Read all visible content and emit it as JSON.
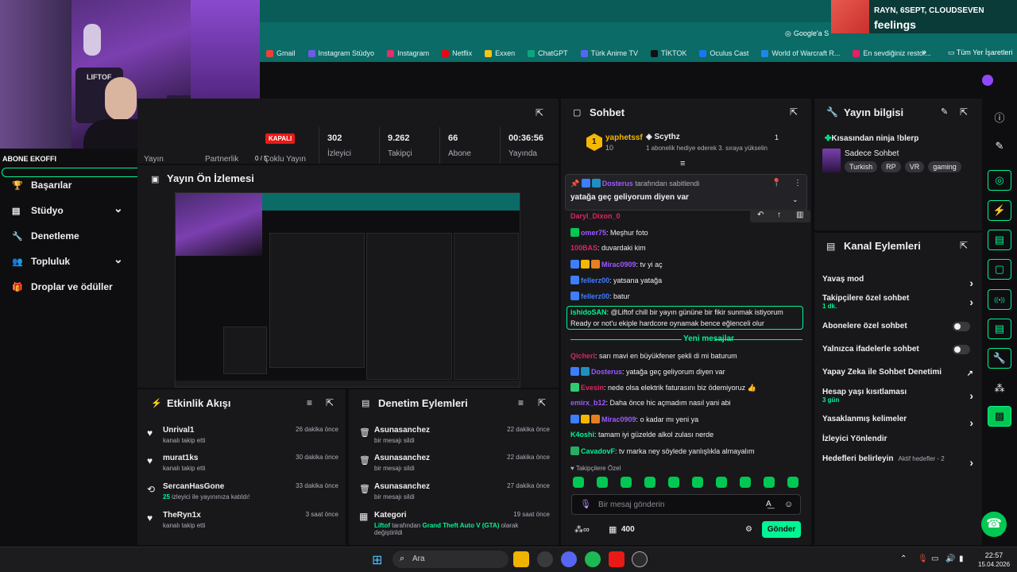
{
  "browser": {
    "google_chip": "Google'a S",
    "bookmarks": [
      "Gmail",
      "Instagram Stüdyo",
      "Instagram",
      "Netflix",
      "Exxen",
      "ChatGPT",
      "Türk Anime TV",
      "TİKTOK",
      "Oculus Cast",
      "World of Warcraft R...",
      "En sevdiğiniz restor..."
    ],
    "bookmark_colors": [
      "#ea4335",
      "#6c5ce7",
      "#e1306c",
      "#e50914",
      "#f5c518",
      "#10a37f",
      "#5865f2",
      "#111111",
      "#1877f2",
      "#1e88e5",
      "#e91e63"
    ],
    "overflow": "»",
    "all_bookmarks": "Tüm Yer İşaretleri"
  },
  "now_playing": {
    "artists": "RAYN, 6SEPT, CLOUDSEVEN",
    "song": "feelings"
  },
  "webcam": {
    "sign": "LIFTOF"
  },
  "left_nav": {
    "overlay_label": "ABONE EKOFFI",
    "items": [
      {
        "label": "Başarılar",
        "icon": "trophy-icon"
      },
      {
        "label": "Stüdyo",
        "icon": "studio-icon",
        "chevron": true
      },
      {
        "label": "Denetleme",
        "icon": "wrench-icon"
      },
      {
        "label": "Topluluk",
        "icon": "community-icon",
        "chevron": true
      },
      {
        "label": "Droplar ve ödüller",
        "icon": "gift-icon"
      }
    ]
  },
  "stats": {
    "yayin": "Yayın",
    "partnerlik": "Partnerlik",
    "partner_count": "0 / 5",
    "coklu": "Çoklu Yayın",
    "status": "KAPALI",
    "viewers": {
      "value": "302",
      "label": "İzleyici"
    },
    "followers": {
      "value": "9.262",
      "label": "Takipçi"
    },
    "subs": {
      "value": "66",
      "label": "Abone"
    },
    "duration": {
      "value": "00:36:56",
      "label": "Yayında"
    }
  },
  "preview": {
    "title": "Yayın Ön İzlemesi"
  },
  "activity": {
    "title": "Etkinlik Akışı",
    "items": [
      {
        "name": "Unrival1",
        "desc": "kanalı takip etti",
        "time": "26 dakika önce",
        "icon": "heart-icon"
      },
      {
        "name": "murat1ks",
        "desc": "kanalı takip etti",
        "time": "30 dakika önce",
        "icon": "heart-icon"
      },
      {
        "name": "SercanHasGone",
        "desc_green": "25",
        "desc": "izleyici ile yayınınıza katıldı!",
        "time": "33 dakika önce",
        "icon": "raid-icon"
      },
      {
        "name": "TheRyn1x",
        "desc": "kanalı takip etti",
        "time": "3 saat önce",
        "icon": "heart-icon"
      }
    ]
  },
  "moderation": {
    "title": "Denetim Eylemleri",
    "items": [
      {
        "name": "Asunasanchez",
        "desc": "bir mesajı sildi",
        "time": "22 dakika önce"
      },
      {
        "name": "Asunasanchez",
        "desc": "bir mesajı sildi",
        "time": "22 dakika önce"
      },
      {
        "name": "Asunasanchez",
        "desc": "bir mesajı sildi",
        "time": "27 dakika önce"
      }
    ],
    "category": {
      "name": "Kategori",
      "time": "19 saat önce",
      "user": "Liftof",
      "mid": "tarafından",
      "game": "Grand Theft Auto V (GTA)",
      "end": "olarak",
      "end2": "değiştirildi"
    }
  },
  "chat": {
    "title": "Sohbet",
    "top_gifter": {
      "name": "yaphetssf",
      "count": "10",
      "rank": "1"
    },
    "hype": {
      "name": "Scythz",
      "text": "1 abonelik hediye ederek 3. sıraya yükselin",
      "count": "1"
    },
    "pinned": {
      "by": "Dosterus",
      "by_suffix": "tarafından sabitlendi",
      "text": "yatağa geç geliyorum diyen var"
    },
    "messages": [
      {
        "user": "Daryl_Dixon_0",
        "color": "#e0245e",
        "text": ""
      },
      {
        "user": "omer75",
        "color": "#9b59ff",
        "text": "Meşhur foto"
      },
      {
        "user": "100BAS",
        "color": "#e0245e",
        "text": "duvardaki kim"
      },
      {
        "user": "Mirac0909",
        "color": "#9b59ff",
        "text": "tv yi aç"
      },
      {
        "user": "fellerz00",
        "color": "#3d7eff",
        "text": "yatsana yatağa"
      },
      {
        "user": "fellerz00",
        "color": "#3d7eff",
        "text": "batur"
      }
    ],
    "highlight": {
      "user": "ishidoSAN",
      "line1": "@Liftof chill bir yayın gününe bir fikir sunmak istiyorum",
      "line2": "Ready or not'u ekiple hardcore oynamak bence eğlenceli olur"
    },
    "new_label": "Yeni mesajlar",
    "messages2": [
      {
        "user": "Qicheri",
        "color": "#e0245e",
        "text": "sarı mavi en büyükfener şekli di mi baturum"
      },
      {
        "user": "Dosterus",
        "color": "#9b59ff",
        "text": "yatağa geç geliyorum diyen var"
      },
      {
        "user": "Evesin",
        "color": "#e0245e",
        "text": "nede olsa elektrik faturasını biz ödemiyoruz 👍"
      },
      {
        "user": "emirx_b12",
        "color": "#9b59ff",
        "text": "Daha önce hic açmadım nasıl yani abi"
      },
      {
        "user": "Mirac0909",
        "color": "#9b59ff",
        "text": "o kadar mı yeni ya"
      },
      {
        "user": "K4oshi",
        "color": "#00f593",
        "text": "tamam iyi güzelde alkol zulası nerde"
      },
      {
        "user": "CavadovF",
        "color": "#00f593",
        "text": "tv marka ney söylede yanlışlıkla almayalım"
      }
    ],
    "followers_only": "Takipçilere Özel",
    "placeholder": "Bir mesaj gönderin",
    "points": "400",
    "send": "Gönder"
  },
  "stream_info": {
    "title": "Yayın bilgisi",
    "stream_title": "Kısasından ninja !blerp",
    "category": "Sadece Sohbet",
    "tags": [
      "Turkish",
      "RP",
      "VR",
      "gaming"
    ]
  },
  "channel_actions": {
    "title": "Kanal Eylemleri",
    "items": [
      {
        "label": "Yavaş mod",
        "type": "chev"
      },
      {
        "label": "Takipçilere özel sohbet",
        "sub": "1 dk.",
        "type": "chev"
      },
      {
        "label": "Abonelere özel sohbet",
        "type": "toggle"
      },
      {
        "label": "Yalnızca ifadelerle sohbet",
        "type": "toggle"
      },
      {
        "label": "Yapay Zeka ile Sohbet Denetimi",
        "type": "ext"
      },
      {
        "label": "Hesap yaşı kısıtlaması",
        "sub": "3 gün",
        "type": "chev"
      },
      {
        "label": "Yasaklanmış kelimeler",
        "type": "chev"
      },
      {
        "label": "İzleyici Yönlendir",
        "type": "none"
      },
      {
        "label": "Hedefleri belirleyin",
        "sub_inline": "Aktif hedefler - 2",
        "type": "chev"
      }
    ]
  },
  "taskbar": {
    "search": "Ara",
    "time": "22:57",
    "date": "15.04.2026"
  }
}
